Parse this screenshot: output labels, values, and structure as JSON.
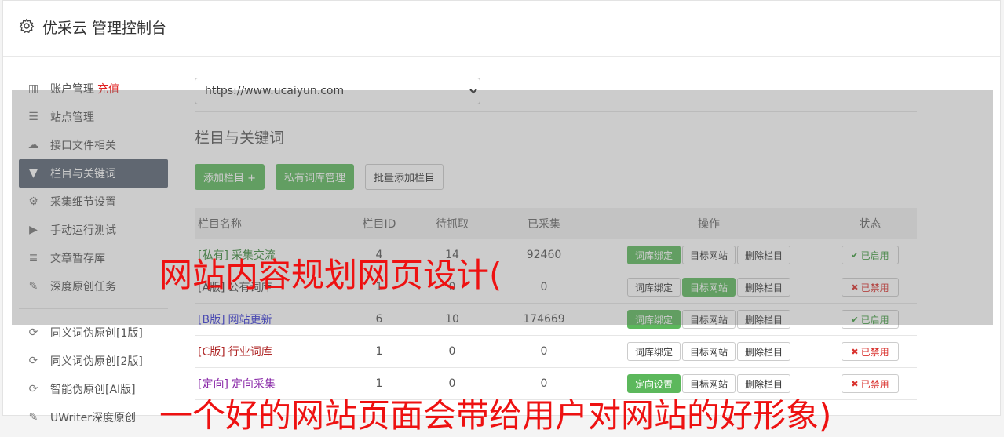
{
  "app": {
    "title": "优采云 管理控制台"
  },
  "sidebar": {
    "items": [
      {
        "label": "账户管理",
        "extra": "充值",
        "icon": "bar-chart-icon"
      },
      {
        "label": "站点管理",
        "icon": "server-icon"
      },
      {
        "label": "接口文件相关",
        "icon": "cloud-upload-icon"
      },
      {
        "label": "栏目与关键词",
        "icon": "filter-icon",
        "active": true
      },
      {
        "label": "采集细节设置",
        "icon": "cogs-icon"
      },
      {
        "label": "手动运行测试",
        "icon": "play-circle-icon"
      },
      {
        "label": "文章暂存库",
        "icon": "database-icon"
      },
      {
        "label": "深度原创任务",
        "icon": "edit-icon"
      }
    ],
    "items2": [
      {
        "label": "同义词伪原创[1版]",
        "icon": "refresh-icon"
      },
      {
        "label": "同义词伪原创[2版]",
        "icon": "refresh-icon"
      },
      {
        "label": "智能伪原创[AI版]",
        "icon": "refresh-icon"
      },
      {
        "label": "UWriter深度原创",
        "icon": "edit-icon"
      }
    ]
  },
  "main": {
    "site_select": {
      "value": "https://www.ucaiyun.com"
    },
    "section_title": "栏目与关键词",
    "buttons": {
      "add_column": "添加栏目 +",
      "private_lib": "私有词库管理",
      "batch_add": "批量添加栏目"
    },
    "table": {
      "headers": [
        "栏目名称",
        "栏目ID",
        "待抓取",
        "已采集",
        "操作",
        "状态"
      ],
      "rows": [
        {
          "tag": "[私有]",
          "name": "采集交流",
          "id": "4",
          "pending": "14",
          "collected": "92460",
          "op1": "词库绑定",
          "op1_active": true,
          "op2": "目标网站",
          "op2_active": false,
          "op3": "删除栏目",
          "status": "已启用",
          "enabled": true,
          "tag_color": "#3c8a3c"
        },
        {
          "tag": "[A版]",
          "name": "公有词库",
          "id": "1",
          "pending": "0",
          "collected": "0",
          "op1": "词库绑定",
          "op1_active": false,
          "op2": "目标网站",
          "op2_active": true,
          "op3": "删除栏目",
          "status": "已禁用",
          "enabled": false,
          "tag_color": "#444444"
        },
        {
          "tag": "[B版]",
          "name": "网站更新",
          "id": "6",
          "pending": "10",
          "collected": "174669",
          "op1": "词库绑定",
          "op1_active": true,
          "op2": "目标网站",
          "op2_active": false,
          "op3": "删除栏目",
          "status": "已启用",
          "enabled": true,
          "tag_color": "#3a3ad8"
        },
        {
          "tag": "[C版]",
          "name": "行业词库",
          "id": "1",
          "pending": "0",
          "collected": "0",
          "op1": "词库绑定",
          "op1_active": false,
          "op2": "目标网站",
          "op2_active": false,
          "op3": "删除栏目",
          "status": "已禁用",
          "enabled": false,
          "tag_color": "#b02a2a"
        },
        {
          "tag": "[定向]",
          "name": "定向采集",
          "id": "1",
          "pending": "0",
          "collected": "0",
          "op1": "定向设置",
          "op1_active": true,
          "op2": "目标网站",
          "op2_active": false,
          "op3": "删除栏目",
          "status": "已禁用",
          "enabled": false,
          "tag_color": "#8a2aa8"
        }
      ]
    }
  },
  "watermark": {
    "line1": "网站内容规划网页设计(",
    "line2": "一个好的网站页面会带给用户对网站的好形象)"
  },
  "colors": {
    "green": "#5cb85c",
    "active_nav": "#5a6573",
    "red": "#e02020"
  }
}
